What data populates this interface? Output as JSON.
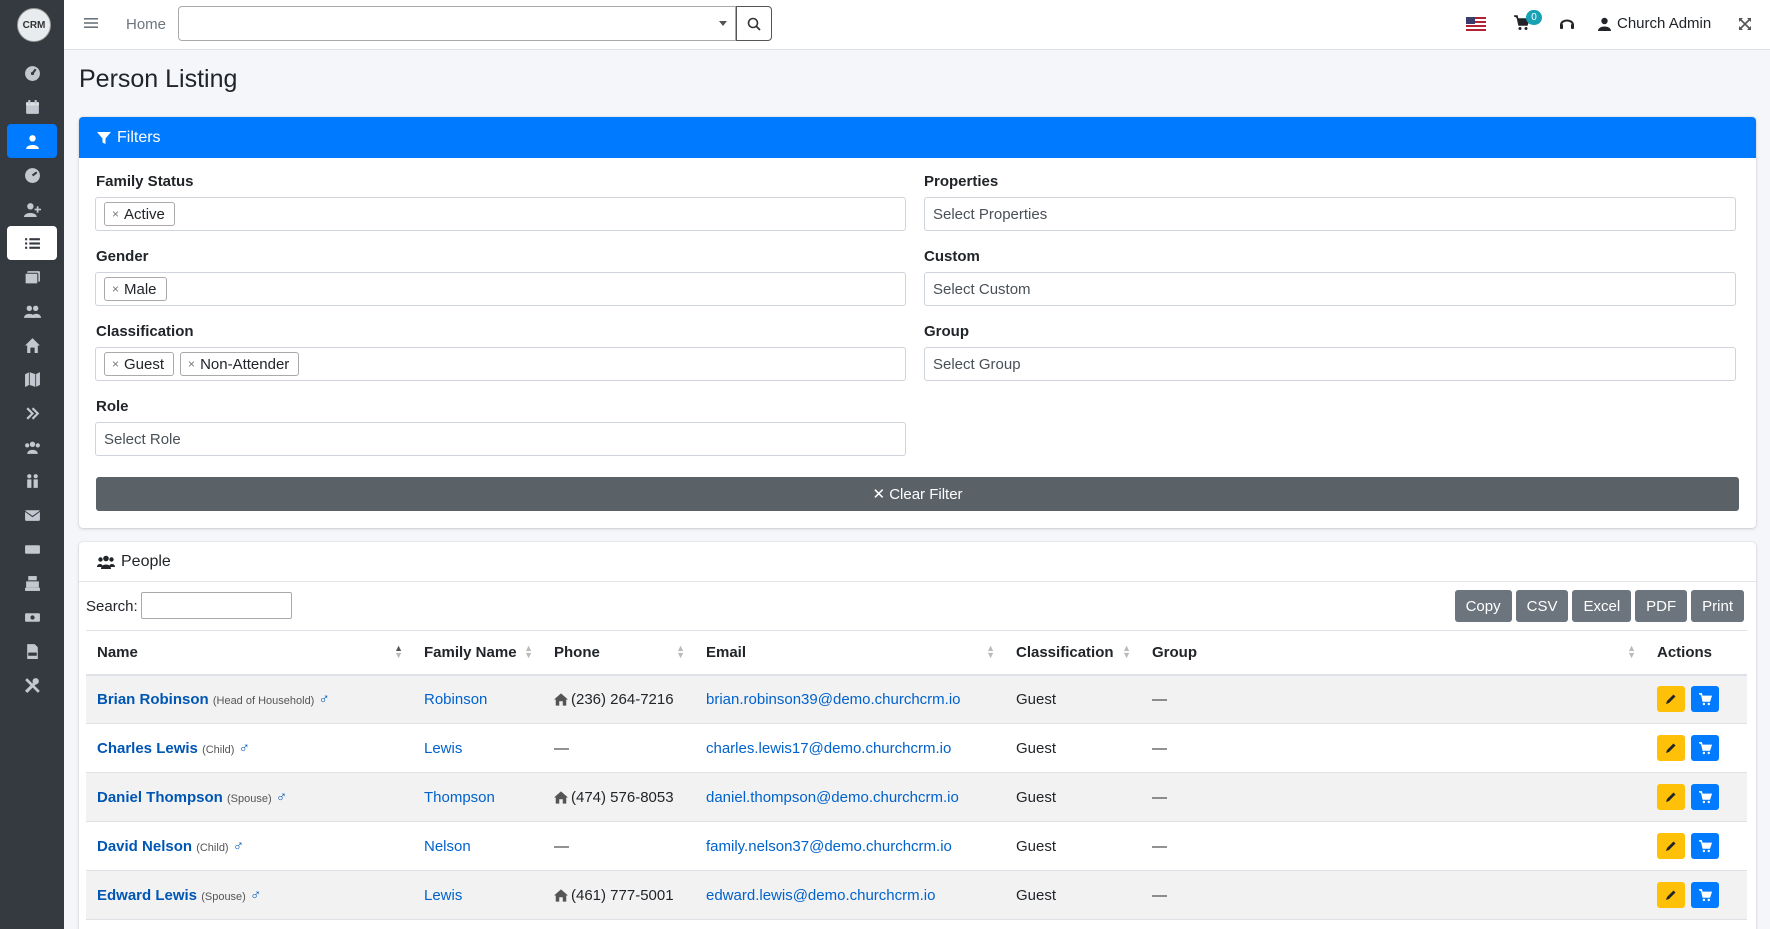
{
  "app": {
    "logo_text": "CRM"
  },
  "nav": {
    "home_label": "Home",
    "cart_count": "0",
    "user_name": "Church Admin"
  },
  "page": {
    "title": "Person Listing"
  },
  "filters": {
    "header": "Filters",
    "family_status": {
      "label": "Family Status",
      "tags": [
        "Active"
      ]
    },
    "gender": {
      "label": "Gender",
      "tags": [
        "Male"
      ]
    },
    "classification": {
      "label": "Classification",
      "tags": [
        "Guest",
        "Non-Attender"
      ]
    },
    "role": {
      "label": "Role",
      "placeholder": "Select Role"
    },
    "properties": {
      "label": "Properties",
      "placeholder": "Select Properties"
    },
    "custom": {
      "label": "Custom",
      "placeholder": "Select Custom"
    },
    "group": {
      "label": "Group",
      "placeholder": "Select Group"
    },
    "clear_label": "✕ Clear Filter"
  },
  "people": {
    "header": "People",
    "search_label": "Search:",
    "export_buttons": [
      "Copy",
      "CSV",
      "Excel",
      "PDF",
      "Print"
    ],
    "columns": [
      "Name",
      "Family Name",
      "Phone",
      "Email",
      "Classification",
      "Group",
      "Actions"
    ],
    "rows": [
      {
        "name": "Brian Robinson",
        "role": "(Head of Household)",
        "family": "Robinson",
        "phone": "(236) 264-7216",
        "has_phone": true,
        "email": "brian.robinson39@demo.churchcrm.io",
        "classification": "Guest",
        "group": "—"
      },
      {
        "name": "Charles Lewis",
        "role": "(Child)",
        "family": "Lewis",
        "phone": "—",
        "has_phone": false,
        "email": "charles.lewis17@demo.churchcrm.io",
        "classification": "Guest",
        "group": "—"
      },
      {
        "name": "Daniel Thompson",
        "role": "(Spouse)",
        "family": "Thompson",
        "phone": "(474) 576-8053",
        "has_phone": true,
        "email": "daniel.thompson@demo.churchcrm.io",
        "classification": "Guest",
        "group": "—"
      },
      {
        "name": "David Nelson",
        "role": "(Child)",
        "family": "Nelson",
        "phone": "—",
        "has_phone": false,
        "email": "family.nelson37@demo.churchcrm.io",
        "classification": "Guest",
        "group": "—"
      },
      {
        "name": "Edward Lewis",
        "role": "(Spouse)",
        "family": "Lewis",
        "phone": "(461) 777-5001",
        "has_phone": true,
        "email": "edward.lewis@demo.churchcrm.io",
        "classification": "Guest",
        "group": "—"
      }
    ]
  },
  "colors": {
    "primary": "#007bff",
    "sidebar": "#343a40",
    "warning": "#ffc107",
    "secondary": "#6c757d"
  }
}
